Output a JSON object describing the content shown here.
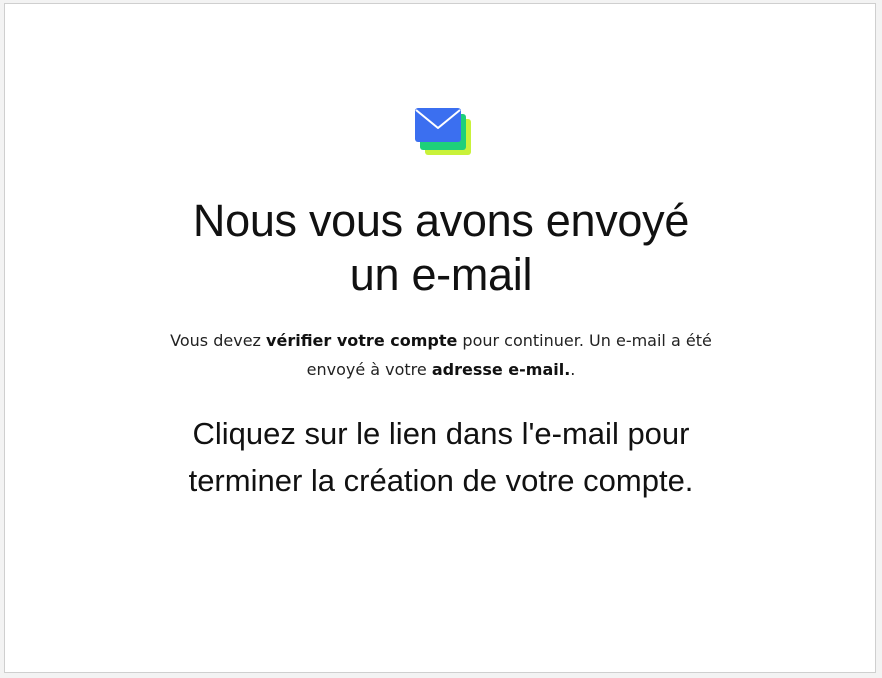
{
  "icon": "email-stack-icon",
  "colors": {
    "envelope_blue": "#3b6ff0",
    "envelope_green": "#1ed07a",
    "envelope_lime": "#c9f23a",
    "text": "#111111"
  },
  "heading": {
    "line1": "Nous vous avons envoyé",
    "line2": "un e-mail"
  },
  "description": {
    "part1": "Vous devez ",
    "bold1": "vérifier votre compte",
    "part2": " pour continuer. Un e-mail a été envoyé à votre ",
    "bold2": "adresse e-mail.",
    "part3": "."
  },
  "instruction": {
    "line1": "Cliquez sur le lien dans l'e-mail pour",
    "line2": "terminer la création de votre compte."
  }
}
